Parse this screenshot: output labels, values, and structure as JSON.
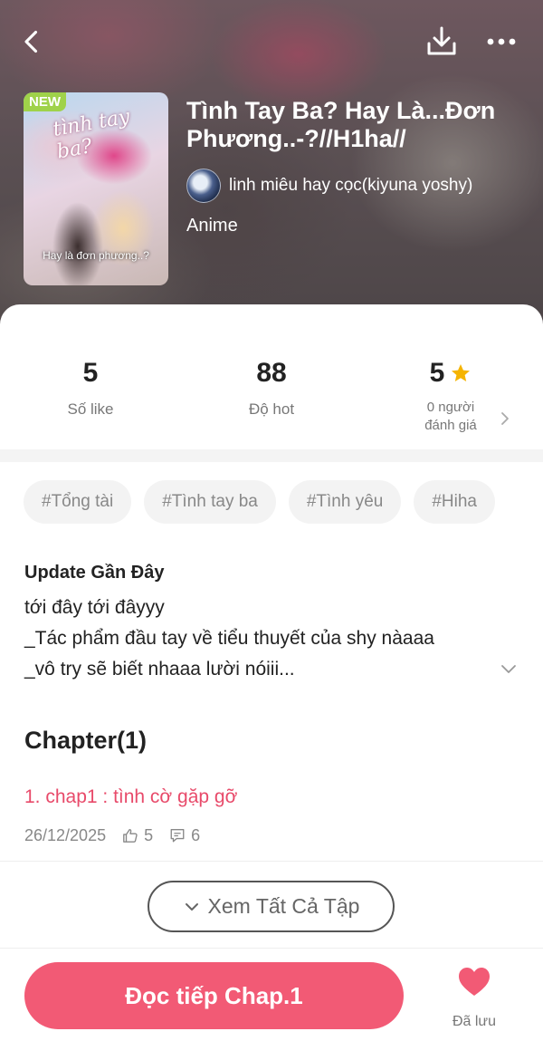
{
  "header": {
    "cover_badge": "NEW",
    "cover_script": "tình tay ba?",
    "cover_caption": "Hay là đơn phương..?",
    "title": "Tình Tay Ba? Hay Là...Đơn Phương..-?//H1ha//",
    "author": "linh miêu hay cọc(kiyuna yoshy)",
    "genre": "Anime",
    "icons": [
      "back-arrow-icon",
      "download-icon",
      "more-icon"
    ]
  },
  "stats": {
    "likes_value": "5",
    "likes_label": "Số like",
    "hot_value": "88",
    "hot_label": "Độ hot",
    "rating_value": "5",
    "rating_label_line1": "0 người",
    "rating_label_line2": "đánh giá"
  },
  "tags": [
    "#Tổng tài",
    "#Tình tay ba",
    "#Tình yêu",
    "#Hiha"
  ],
  "update": {
    "title": "Update Gần Đây",
    "lines": [
      "tới đây tới đâyyy",
      "_Tác phẩm đầu tay về tiểu thuyết của shy nàaaa",
      "_vô try sẽ biết nhaaa lười nóiii..."
    ]
  },
  "chapters": {
    "heading": "Chapter(1)",
    "items": [
      {
        "title": "1. chap1 : tình cờ gặp gỡ",
        "date": "26/12/2025",
        "likes": "5",
        "comments": "6"
      }
    ],
    "view_all_label": "Xem Tất Cả Tập"
  },
  "footer": {
    "read_button": "Đọc tiếp Chap.1",
    "saved_label": "Đã lưu"
  },
  "colors": {
    "accent": "#f25a75",
    "chapter_link": "#e84a6a",
    "star": "#f5b400",
    "new_badge": "#9fd24a"
  }
}
